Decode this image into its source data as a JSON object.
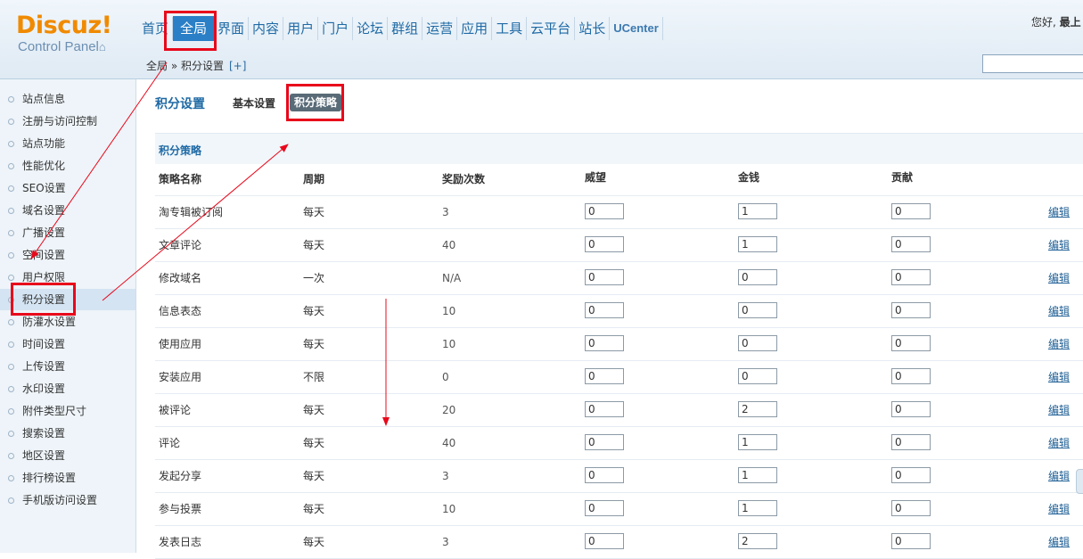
{
  "logo": {
    "main": "Discuz!",
    "sub": "Control Panel",
    "icon": "home-icon"
  },
  "topnav": [
    {
      "label": "首页",
      "active": false
    },
    {
      "label": "全局",
      "active": true
    },
    {
      "label": "界面",
      "active": false
    },
    {
      "label": "内容",
      "active": false
    },
    {
      "label": "用户",
      "active": false
    },
    {
      "label": "门户",
      "active": false
    },
    {
      "label": "论坛",
      "active": false
    },
    {
      "label": "群组",
      "active": false
    },
    {
      "label": "运营",
      "active": false
    },
    {
      "label": "应用",
      "active": false
    },
    {
      "label": "工具",
      "active": false
    },
    {
      "label": "云平台",
      "active": false
    },
    {
      "label": "站长",
      "active": false
    },
    {
      "label": "UCenter",
      "active": false
    }
  ],
  "greeting": {
    "prefix": "您好, ",
    "user": "最上"
  },
  "breadcrumb": {
    "path": "全局 » 积分设置",
    "add": "[+]"
  },
  "search": {
    "value": ""
  },
  "sidebar": [
    {
      "label": "站点信息"
    },
    {
      "label": "注册与访问控制"
    },
    {
      "label": "站点功能"
    },
    {
      "label": "性能优化"
    },
    {
      "label": "SEO设置"
    },
    {
      "label": "域名设置"
    },
    {
      "label": "广播设置"
    },
    {
      "label": "空间设置"
    },
    {
      "label": "用户权限"
    },
    {
      "label": "积分设置",
      "active": true
    },
    {
      "label": "防灌水设置"
    },
    {
      "label": "时间设置"
    },
    {
      "label": "上传设置"
    },
    {
      "label": "水印设置"
    },
    {
      "label": "附件类型尺寸"
    },
    {
      "label": "搜索设置"
    },
    {
      "label": "地区设置"
    },
    {
      "label": "排行榜设置"
    },
    {
      "label": "手机版访问设置"
    }
  ],
  "main": {
    "title": "积分设置",
    "tabs": [
      {
        "label": "基本设置",
        "active": false
      },
      {
        "label": "积分策略",
        "active": true
      }
    ],
    "section_title": "积分策略",
    "columns": [
      "策略名称",
      "周期",
      "奖励次数",
      "威望",
      "金钱",
      "贡献"
    ],
    "edit_label": "编辑",
    "rows": [
      {
        "name": "淘专辑被订阅",
        "cycle": "每天",
        "times": "3",
        "weiwang": "0",
        "jinqian": "1",
        "gongxian": "0"
      },
      {
        "name": "文章评论",
        "cycle": "每天",
        "times": "40",
        "weiwang": "0",
        "jinqian": "1",
        "gongxian": "0"
      },
      {
        "name": "修改域名",
        "cycle": "一次",
        "times": "N/A",
        "weiwang": "0",
        "jinqian": "0",
        "gongxian": "0"
      },
      {
        "name": "信息表态",
        "cycle": "每天",
        "times": "10",
        "weiwang": "0",
        "jinqian": "0",
        "gongxian": "0"
      },
      {
        "name": "使用应用",
        "cycle": "每天",
        "times": "10",
        "weiwang": "0",
        "jinqian": "0",
        "gongxian": "0"
      },
      {
        "name": "安装应用",
        "cycle": "不限",
        "times": "0",
        "weiwang": "0",
        "jinqian": "0",
        "gongxian": "0"
      },
      {
        "name": "被评论",
        "cycle": "每天",
        "times": "20",
        "weiwang": "0",
        "jinqian": "2",
        "gongxian": "0"
      },
      {
        "name": "评论",
        "cycle": "每天",
        "times": "40",
        "weiwang": "0",
        "jinqian": "1",
        "gongxian": "0"
      },
      {
        "name": "发起分享",
        "cycle": "每天",
        "times": "3",
        "weiwang": "0",
        "jinqian": "1",
        "gongxian": "0"
      },
      {
        "name": "参与投票",
        "cycle": "每天",
        "times": "10",
        "weiwang": "0",
        "jinqian": "1",
        "gongxian": "0"
      },
      {
        "name": "发表日志",
        "cycle": "每天",
        "times": "3",
        "weiwang": "0",
        "jinqian": "2",
        "gongxian": "0"
      }
    ]
  },
  "colors": {
    "accent": "#2a7fc6",
    "logo": "#f08a00",
    "annotation": "#e8081b"
  }
}
